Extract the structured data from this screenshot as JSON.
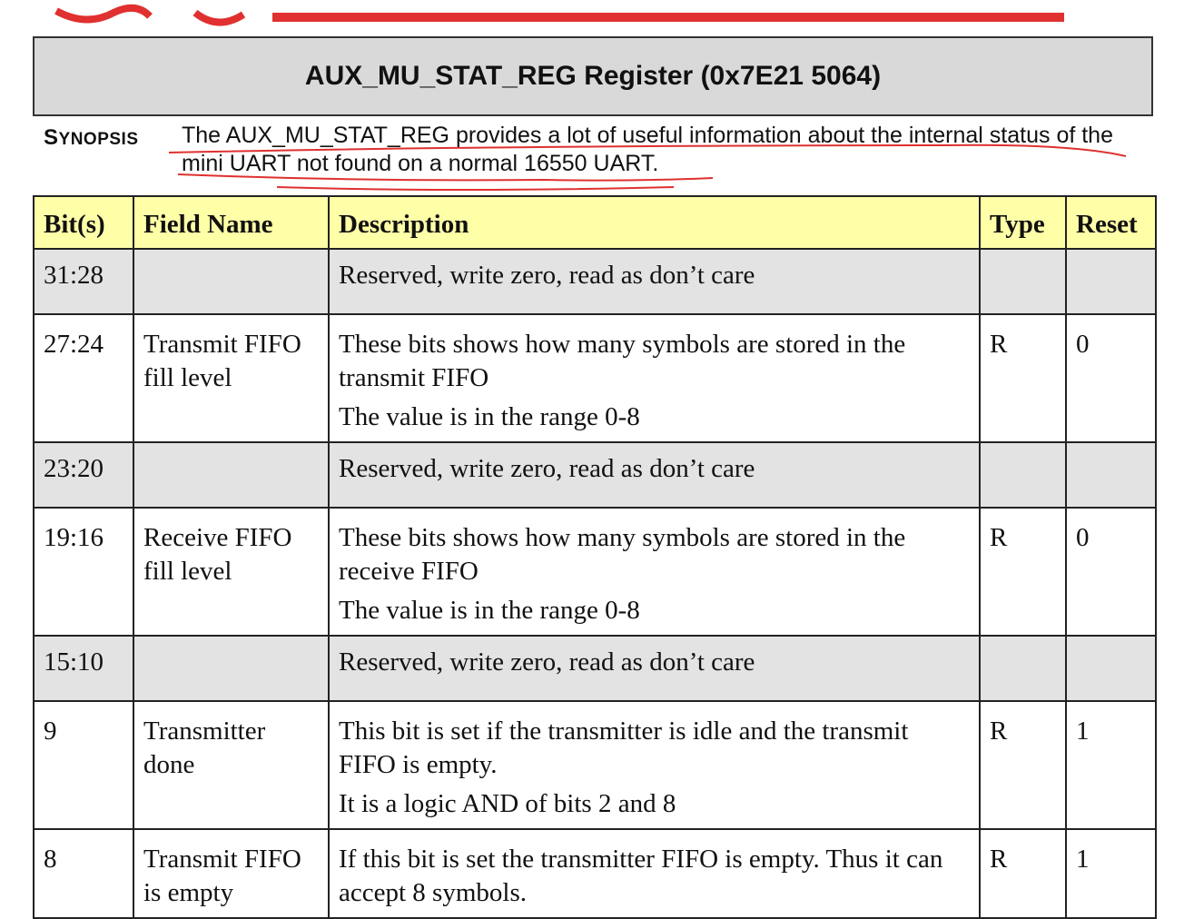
{
  "title": "AUX_MU_STAT_REG Register (0x7E21 5064)",
  "synopsis": {
    "label": "Synopsis",
    "text": "The AUX_MU_STAT_REG provides a lot of useful information about the internal status of the mini UART not found on a normal 16550 UART."
  },
  "table": {
    "headers": [
      "Bit(s)",
      "Field Name",
      "Description",
      "Type",
      "Reset"
    ],
    "rows": [
      {
        "bits": "31:28",
        "field": "",
        "desc": "Reserved, write zero, read as don’t care",
        "desc2": "",
        "type": "",
        "reset": "",
        "reserved": true
      },
      {
        "bits": "27:24",
        "field": "Transmit FIFO fill level",
        "desc": "These bits shows how many symbols are stored in the transmit FIFO",
        "desc2": "The value is in the range 0-8",
        "type": "R",
        "reset": "0"
      },
      {
        "bits": "23:20",
        "field": "",
        "desc": "Reserved, write zero, read as don’t care",
        "desc2": "",
        "type": "",
        "reset": "",
        "reserved": true
      },
      {
        "bits": "19:16",
        "field": "Receive FIFO fill level",
        "desc": "These bits shows how many symbols are stored in the receive FIFO",
        "desc2": "The value is in the range 0-8",
        "type": "R",
        "reset": "0"
      },
      {
        "bits": "15:10",
        "field": "",
        "desc": "Reserved, write zero, read as don’t care",
        "desc2": "",
        "type": "",
        "reset": "",
        "reserved": true
      },
      {
        "bits": "9",
        "field": "Transmitter done",
        "desc": "This bit is set if the transmitter is idle and the transmit FIFO is empty.",
        "desc2": "It is a logic AND of bits 2 and 8",
        "type": "R",
        "reset": "1"
      },
      {
        "bits": "8",
        "field": "Transmit FIFO is empty",
        "desc": "If this bit is set the transmitter FIFO is empty. Thus it can accept 8 symbols.",
        "desc2": "",
        "type": "R",
        "reset": "1"
      }
    ]
  },
  "colors": {
    "header_bg": "#ffffa8",
    "reserved_bg": "#e3e3e3",
    "title_bg": "#d9d9d9",
    "annotation_red": "#e03030"
  }
}
